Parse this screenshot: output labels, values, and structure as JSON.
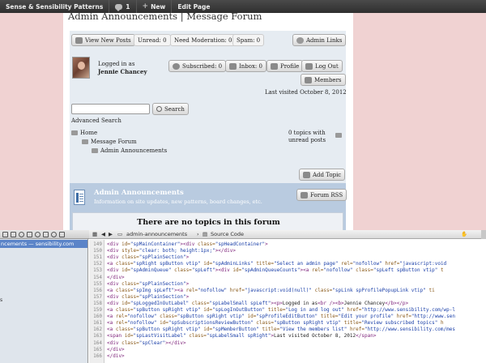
{
  "admin_bar": {
    "site_name": "Sense & Sensibility Patterns",
    "comments_count": "1",
    "new_label": "New",
    "edit_label": "Edit Page"
  },
  "page": {
    "title": "Admin Announcements | Message Forum"
  },
  "forum": {
    "toolbar": {
      "view_new_posts": "View New Posts",
      "unread": "Unread: 0",
      "need_moderation": "Need Moderation: 0",
      "spam": "Spam: 0",
      "admin_links": "Admin Links"
    },
    "user": {
      "logged_in_as": "Logged in as",
      "name": "Jennie Chancey",
      "subscribed": "Subscribed: 0",
      "inbox": "Inbox: 0",
      "profile": "Profile",
      "log_out": "Log Out",
      "members": "Members",
      "last_visited": "Last visited October 8, 2012"
    },
    "search": {
      "button": "Search",
      "advanced": "Advanced Search",
      "value": ""
    },
    "breadcrumb": {
      "home": "Home",
      "message_forum": "Message Forum",
      "admin_announcements": "Admin Announcements"
    },
    "topics_status_line1": "0 topics with",
    "topics_status_line2": "unread posts",
    "add_topic": "Add Topic",
    "section": {
      "title": "Admin Announcements",
      "description": "Information on site updates, new patterns, board changes, etc.",
      "forum_rss": "Forum RSS",
      "no_topics": "There are no topics in this forum"
    }
  },
  "inspector": {
    "sidebar_selected": "ncements — sensibility.com",
    "sidebar_fragment": "s",
    "nav_resource": "admin-announcements",
    "nav_view": "Source Code",
    "lines": [
      {
        "n": "149",
        "html": "<span class=\"tag\">&lt;div</span> <span class=\"attr\">id=</span><span class=\"val\">\"spMainContainer\"</span><span class=\"tag\">&gt;&lt;div</span> <span class=\"attr\">class=</span><span class=\"val\">\"spHeadContainer\"</span><span class=\"tag\">&gt;</span>"
      },
      {
        "n": "150",
        "html": "<span class=\"tag\">&lt;div</span> <span class=\"attr\">style=</span><span class=\"val\">\"clear: both; height:1px;\"</span><span class=\"tag\">&gt;&lt;/div&gt;</span>"
      },
      {
        "n": "151",
        "html": "<span class=\"tag\">&lt;div</span> <span class=\"attr\">class=</span><span class=\"val\">\"spPlainSection\"</span><span class=\"tag\">&gt;</span>"
      },
      {
        "n": "152",
        "html": "<span class=\"tag\">&lt;a</span> <span class=\"attr\">class=</span><span class=\"val\">\"spRight spButton vtip\"</span> <span class=\"attr\">id=</span><span class=\"val\">\"spAdminLinks\"</span> <span class=\"attr\">title=</span><span class=\"val\">\"Select an admin page\"</span> <span class=\"attr\">rel=</span><span class=\"val\">\"nofollow\"</span> <span class=\"attr\">href=</span><span class=\"val\">\"javascript:void</span>"
      },
      {
        "n": "153",
        "html": "<span class=\"tag\">&lt;div</span> <span class=\"attr\">id=</span><span class=\"val\">\"spAdminQueue\"</span> <span class=\"attr\">class=</span><span class=\"val\">\"spLeft\"</span><span class=\"tag\">&gt;&lt;div</span> <span class=\"attr\">id=</span><span class=\"val\">\"spAdminQueueCounts\"</span><span class=\"tag\">&gt;&lt;a</span> <span class=\"attr\">rel=</span><span class=\"val\">\"nofollow\"</span> <span class=\"attr\">class=</span><span class=\"val\">\"spLeft spButton vtip\"</span> <span class=\"attr\">t</span>"
      },
      {
        "n": "154",
        "html": "<span class=\"tag\">&lt;/div&gt;</span>"
      },
      {
        "n": "155",
        "html": "<span class=\"tag\">&lt;div</span> <span class=\"attr\">class=</span><span class=\"val\">\"spPlainSection\"</span><span class=\"tag\">&gt;</span>"
      },
      {
        "n": "156",
        "html": "<span class=\"tag\">&lt;a</span> <span class=\"attr\">class=</span><span class=\"val\">\"spImg spLeft\"</span><span class=\"tag\">&gt;&lt;a</span> <span class=\"attr\">rel=</span><span class=\"val\">\"nofollow\"</span> <span class=\"attr\">href=</span><span class=\"val\">\"javascript:void(null)\"</span> <span class=\"attr\">class=</span><span class=\"val\">\"spLink spProfilePopupLink vtip\"</span> <span class=\"attr\">ti</span>"
      },
      {
        "n": "157",
        "html": "<span class=\"tag\">&lt;div</span> <span class=\"attr\">class=</span><span class=\"val\">\"spPlainSection\"</span><span class=\"tag\">&gt;</span>"
      },
      {
        "n": "158",
        "html": "<span class=\"tag\">&lt;div</span> <span class=\"attr\">id=</span><span class=\"val\">\"spLoggedInOutLabel\"</span> <span class=\"attr\">class=</span><span class=\"val\">\"spLabelSmall spLeft\"</span><span class=\"tag\">&gt;&lt;p&gt;</span>Logged in as<span class=\"tag\">&lt;br /&gt;&lt;b&gt;</span>Jennie Chancey<span class=\"tag\">&lt;/b&gt;&lt;/p&gt;</span>"
      },
      {
        "n": "159",
        "html": "<span class=\"tag\">&lt;a</span> <span class=\"attr\">class=</span><span class=\"val\">\"spButton spRight vtip\"</span> <span class=\"attr\">id=</span><span class=\"val\">\"spLogInOutButton\"</span> <span class=\"attr\">title=</span><span class=\"val\">\"Log in and log out\"</span> <span class=\"attr\">href=</span><span class=\"val\">\"http://www.sensibility.com/wp-l</span>"
      },
      {
        "n": "160",
        "html": "<span class=\"tag\">&lt;a</span> <span class=\"attr\">rel=</span><span class=\"val\">\"nofollow\"</span> <span class=\"attr\">class=</span><span class=\"val\">\"spButton spRight vtip\"</span> <span class=\"attr\">id=</span><span class=\"val\">\"spProfileEditButton\"</span> <span class=\"attr\">title=</span><span class=\"val\">\"Edit your profile\"</span> <span class=\"attr\">href=</span><span class=\"val\">\"http://www.sen</span>"
      },
      {
        "n": "161",
        "html": "<span class=\"tag\">&lt;a</span> <span class=\"attr\">rel=</span><span class=\"val\">\"nofollow\"</span> <span class=\"attr\">id=</span><span class=\"val\">\"spSubscriptionsReviewButton\"</span> <span class=\"attr\">class=</span><span class=\"val\">\"spButton spRight vtip\"</span> <span class=\"attr\">title=</span><span class=\"val\">\"Review subscribed topics\"</span> <span class=\"attr\">h</span>"
      },
      {
        "n": "162",
        "html": "<span class=\"tag\">&lt;a</span> <span class=\"attr\">class=</span><span class=\"val\">\"spButton spRight vtip\"</span> <span class=\"attr\">id=</span><span class=\"val\">\"spMemberButton\"</span> <span class=\"attr\">title=</span><span class=\"val\">\"View the members list\"</span> <span class=\"attr\">href=</span><span class=\"val\">\"http://www.sensibility.com/mes</span>"
      },
      {
        "n": "163",
        "html": "<span class=\"tag\">&lt;span</span> <span class=\"attr\">id=</span><span class=\"val\">\"spLastVisitLabel\"</span> <span class=\"attr\">class=</span><span class=\"val\">\"spLabelSmall spRight\"</span><span class=\"tag\">&gt;</span>Last visited October 8, 2012<span class=\"tag\">&lt;/span&gt;</span>"
      },
      {
        "n": "164",
        "html": "<span class=\"tag\">&lt;div</span> <span class=\"attr\">class=</span><span class=\"val\">\"spClear\"</span><span class=\"tag\">&gt;&lt;/div&gt;</span>"
      },
      {
        "n": "165",
        "html": "<span class=\"tag\">&lt;/div&gt;</span>"
      },
      {
        "n": "166",
        "html": "<span class=\"tag\">&lt;/div&gt;</span>"
      }
    ]
  }
}
